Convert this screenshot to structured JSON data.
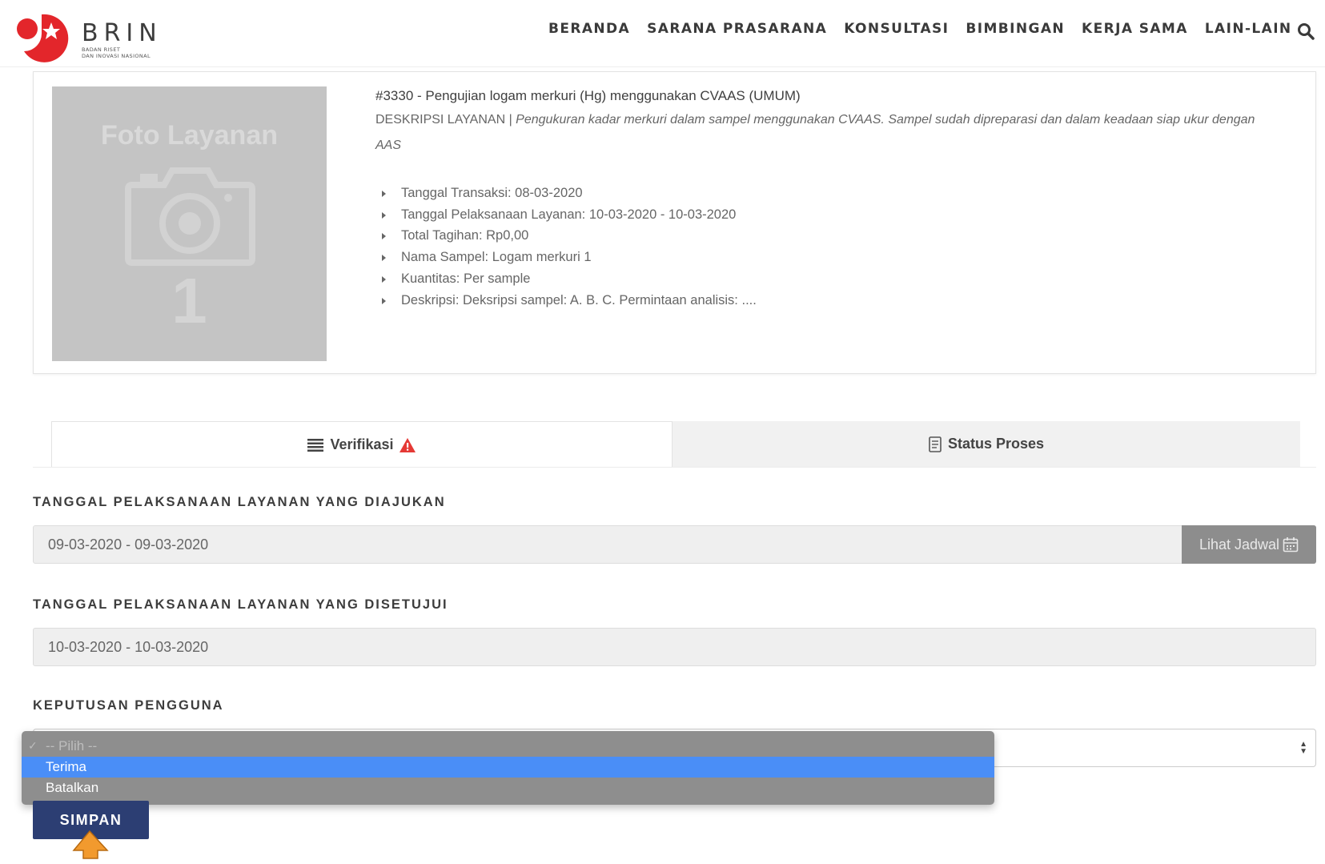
{
  "brand": {
    "name": "BRIN",
    "subtitle_line1": "BADAN RISET",
    "subtitle_line2": "DAN INOVASI NASIONAL"
  },
  "nav": {
    "items": [
      "BERANDA",
      "SARANA PRASARANA",
      "KONSULTASI",
      "BIMBINGAN",
      "KERJA SAMA",
      "LAIN-LAIN"
    ]
  },
  "service": {
    "photo_title": "Foto Layanan",
    "photo_number": "1",
    "title": "#3330 - Pengujian logam merkuri (Hg) menggunakan CVAAS (UMUM)",
    "desc_label": "DESKRIPSI LAYANAN | ",
    "desc_text": "Pengukuran kadar merkuri dalam sampel menggunakan CVAAS. Sampel sudah dipreparasi dan dalam keadaan siap ukur dengan AAS",
    "details": [
      "Tanggal Transaksi: 08-03-2020",
      "Tanggal Pelaksanaan Layanan: 10-03-2020 - 10-03-2020",
      "Total Tagihan: Rp0,00",
      "Nama Sampel: Logam merkuri 1",
      "Kuantitas: Per sample",
      "Deskripsi: Deksripsi sampel: A. B. C. Permintaan analisis: ...."
    ]
  },
  "tabs": {
    "verifikasi": "Verifikasi",
    "status_proses": "Status Proses"
  },
  "form": {
    "requested_label": "TANGGAL PELAKSANAAN LAYANAN YANG DIAJUKAN",
    "requested_value": "09-03-2020 - 09-03-2020",
    "schedule_button": "Lihat Jadwal",
    "approved_label": "TANGGAL PELAKSANAAN LAYANAN YANG DISETUJUI",
    "approved_value": "10-03-2020 - 10-03-2020",
    "decision_label": "KEPUTUSAN PENGGUNA",
    "decision_options": [
      "-- Pilih --",
      "Terima",
      "Batalkan"
    ],
    "highlighted_option": "Terima",
    "save_button": "SIMPAN"
  },
  "colors": {
    "brand_red": "#e3262b",
    "nav_text": "#3a3a3a",
    "save_button": "#2c3e73",
    "dropdown_highlight": "#4a8ef7",
    "warning_icon": "#e53935",
    "cursor": "#f29a2e"
  },
  "icons": [
    "search-icon",
    "camera-icon",
    "list-icon",
    "warning-icon",
    "document-icon",
    "calendar-icon",
    "check-icon",
    "select-arrows-icon",
    "pointer-cursor-icon"
  ]
}
